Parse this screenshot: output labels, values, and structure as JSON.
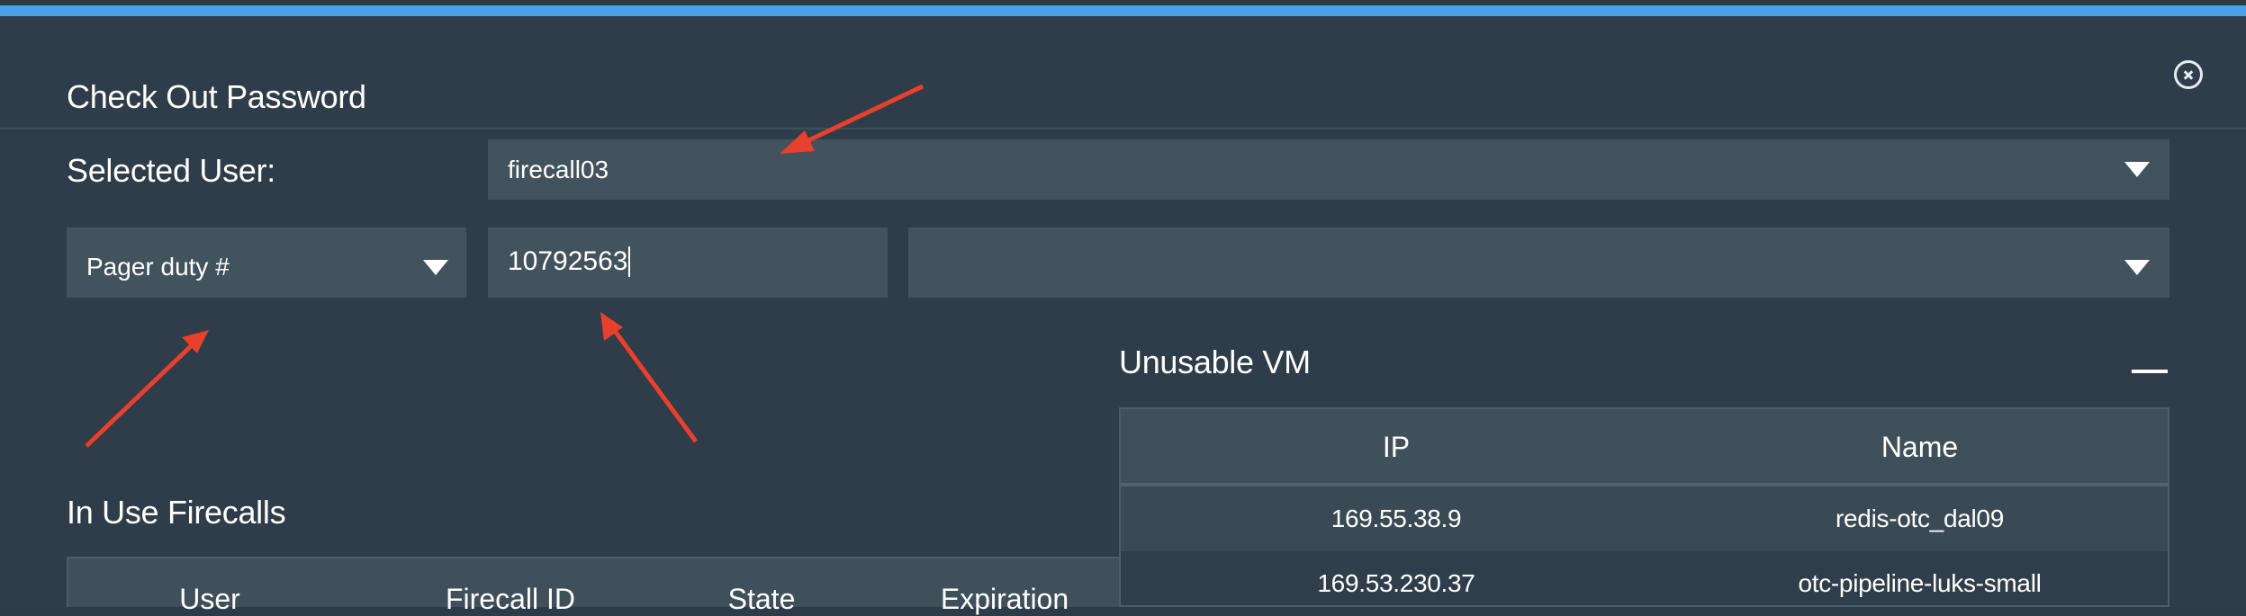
{
  "dialog": {
    "title": "Check Out Password"
  },
  "selected_user": {
    "label": "Selected User:",
    "value": "firecall03"
  },
  "lookup": {
    "type_value": "Pager duty #",
    "input_value": "10792563",
    "second_select_value": ""
  },
  "unusable_vm": {
    "title": "Unusable VM",
    "columns": [
      "IP",
      "Name"
    ],
    "rows": [
      {
        "ip": "169.55.38.9",
        "name": "redis-otc_dal09"
      },
      {
        "ip": "169.53.230.37",
        "name": "otc-pipeline-luks-small"
      }
    ]
  },
  "in_use_firecalls": {
    "title": "In Use Firecalls",
    "columns": [
      "User",
      "Firecall ID",
      "State",
      "Expiration"
    ]
  },
  "colors": {
    "accent_bar": "#4aa0e6",
    "annotation_arrow": "#e8402a",
    "field_bg": "#42535e",
    "modal_bg": "#2e3d49"
  },
  "icons": {
    "close": "close-circle-icon",
    "dropdown": "caret-down-icon",
    "collapse": "minus-icon"
  }
}
